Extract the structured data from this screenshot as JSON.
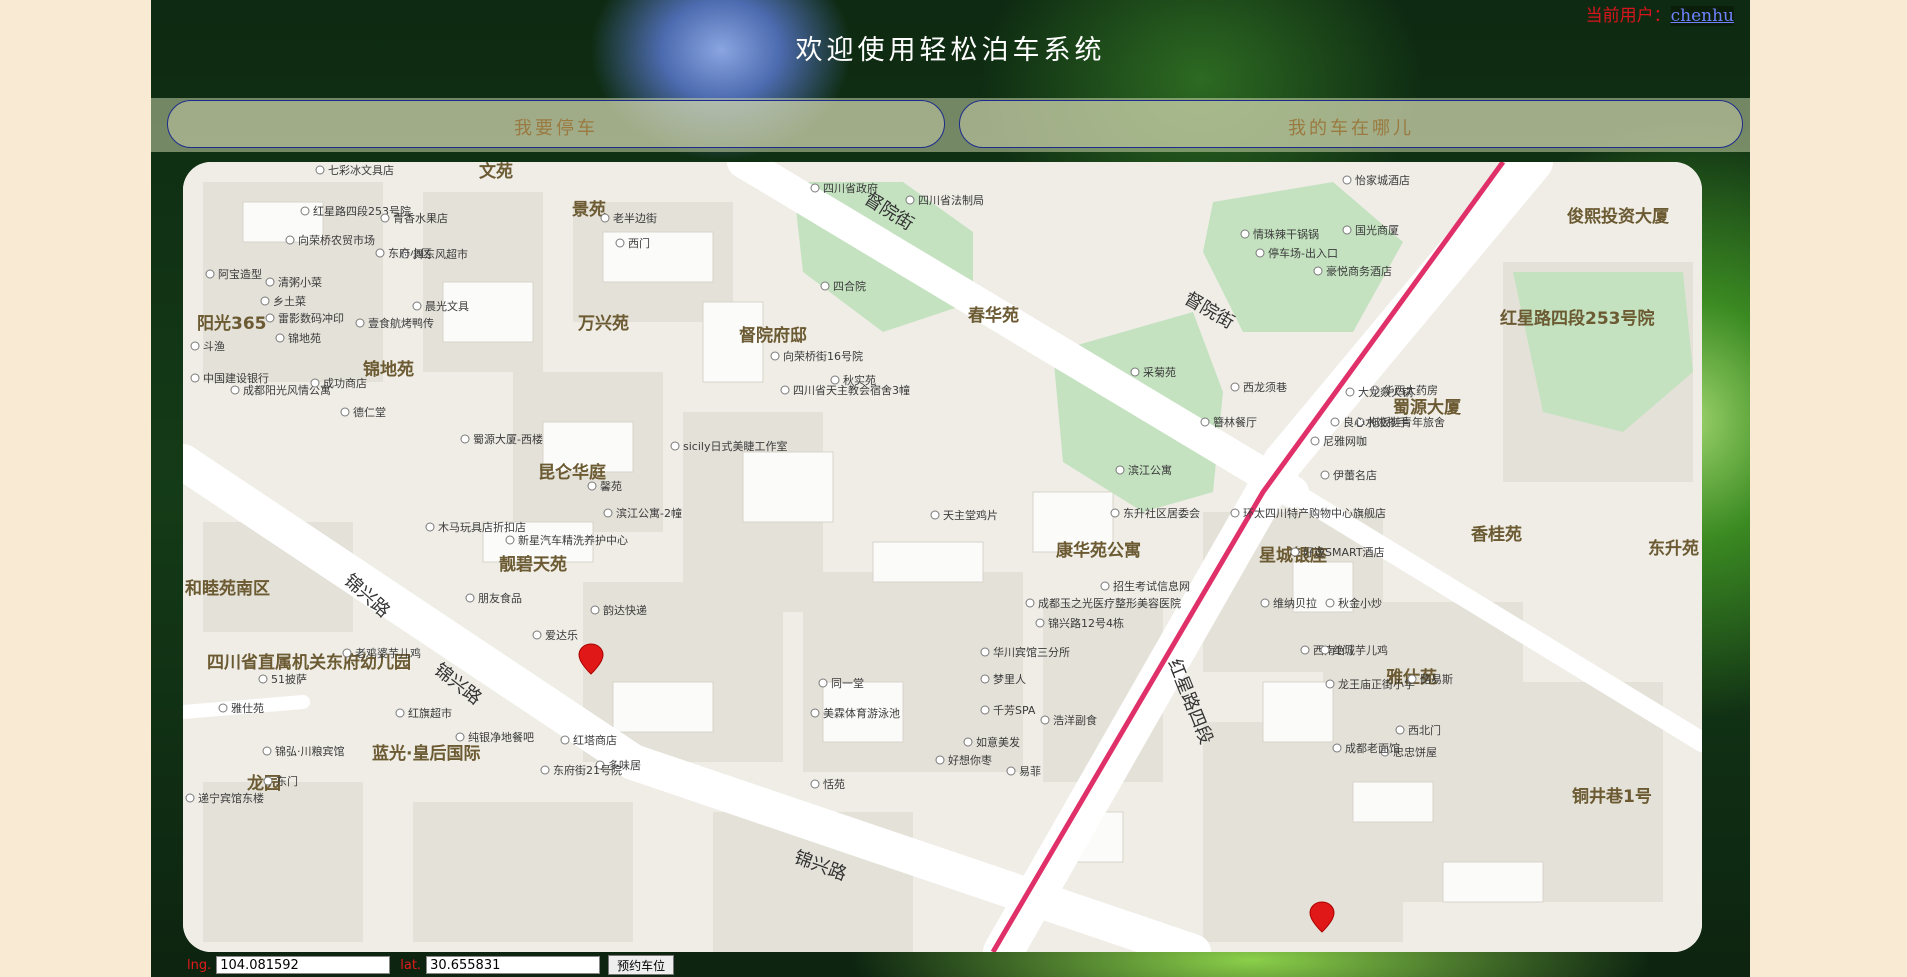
{
  "header": {
    "title": "欢迎使用轻松泊车系统",
    "user_label": "当前用户：",
    "username": "chenhu"
  },
  "nav": {
    "park": "我要停车",
    "find_car": "我的车在哪儿"
  },
  "map": {
    "roads": [
      "督院街",
      "督院街",
      "锦兴路",
      "锦兴路",
      "锦兴路",
      "红星路四段"
    ],
    "areas": [
      "文苑",
      "景苑",
      "万兴苑",
      "督院府邸",
      "春华苑",
      "俊熙投资大厦",
      "红星路四段253号院",
      "阳光365",
      "锦地苑",
      "蜀源大厦",
      "昆仑华庭",
      "香桂苑",
      "东升苑",
      "星城银座",
      "康华苑公寓",
      "靓碧天苑",
      "和睦苑南区",
      "雅仕苑",
      "四川省直属机关东府幼儿园",
      "蓝光·皇后国际",
      "龙园",
      "铜井巷1号"
    ],
    "pois": [
      "七彩冰文具店",
      "四川省政府",
      "四川省法制局",
      "老半边街",
      "西门",
      "怡家城酒店",
      "国光商厦",
      "情珠辣干锅锅",
      "停车场-出入口",
      "豪悦商务酒店",
      "红星路四段253号院",
      "青香水果店",
      "向荣桥农贸市场",
      "舞东风超市",
      "阿宝造型",
      "清粥小菜",
      "乡土菜",
      "雷影数码冲印",
      "壹食航烤鸭传",
      "斗渔",
      "锦地苑",
      "中国建设银行",
      "成都阳光风情公寓",
      "德仁堂",
      "成功商店",
      "向荣桥街16号院",
      "四川省天主教会宿舍3幢",
      "秋实苑",
      "四合院",
      "采菊苑",
      "西龙须巷",
      "华西大药房",
      "大龙燚火锅",
      "拖板鞋青年旅舍",
      "良心水饺抄手",
      "尼雅网咖",
      "簪林餐厅",
      "蜀源大厦-西楼",
      "sicily日式美睫工作室",
      "馨苑",
      "滨江公寓-2幢",
      "滨江公寓",
      "伊蕾名店",
      "东升社区居委会",
      "环太四川特产购物中心旗舰店",
      "天主堂鸡片",
      "好逸SMART酒店",
      "木马玩具店折扣店",
      "新星汽车精洗养护中心",
      "招生考试信息网",
      "成都玉之光医疗整形美容医院",
      "维纳贝拉",
      "秋金小炒",
      "朋友食品",
      "韵达快递",
      "锦兴路12号4栋",
      "爱达乐",
      "西南1门",
      "绝城芋儿鸡",
      "龙王庙正街小学",
      "老鸡婆芋儿鸡",
      "51披萨",
      "同一堂",
      "华川宾馆三分所",
      "梦里人",
      "路易斯",
      "雅仕苑",
      "红旗超市",
      "美霖体育游泳池",
      "千芳SPA",
      "浩洋副食",
      "西北门",
      "忠忠饼屋",
      "纯银净地餐吧",
      "红塔商店",
      "如意美发",
      "好想你枣",
      "易菲",
      "多味居",
      "锦弘·川粮宾馆",
      "东府街21号院",
      "恬苑",
      "东门",
      "递宁宾馆东楼",
      "成都老面馆",
      "东府小区",
      "晨光文具"
    ],
    "marker_colors": [
      "#e01818"
    ]
  },
  "coords": {
    "lng_label": "lng.",
    "lng_value": "104.081592",
    "lat_label": "lat.",
    "lat_value": "30.655831",
    "reserve_label": "预约车位"
  },
  "colors": {
    "page_bg": "#f9ead4",
    "user_label": "#d8141c",
    "link": "#6f82ff",
    "nav_text": "#9a7a40",
    "main_road": "#e0306a"
  }
}
